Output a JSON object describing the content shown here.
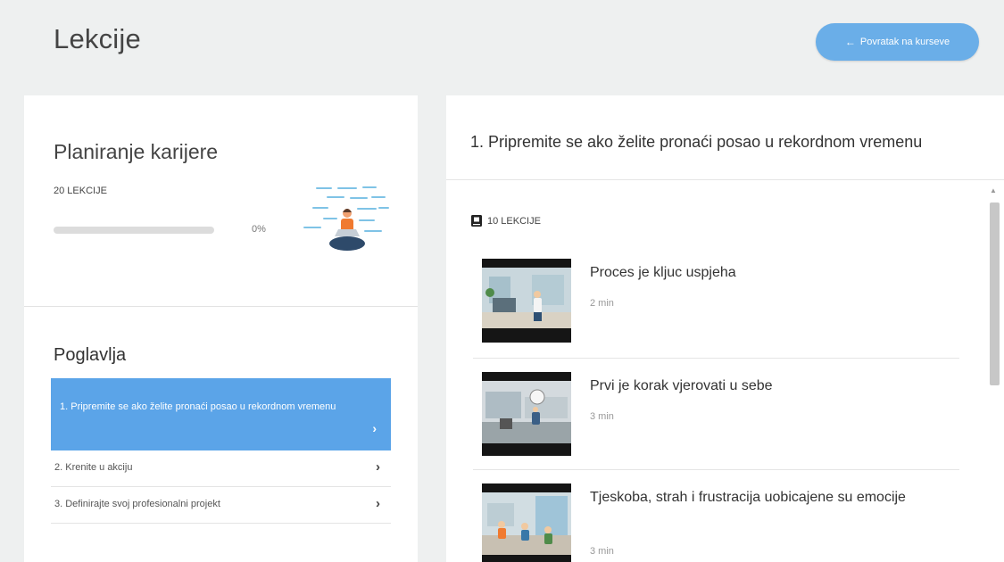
{
  "header": {
    "title": "Lekcije",
    "back_label": "Povratak na kurseve"
  },
  "course": {
    "title": "Planiranje karijere",
    "lessons_count": "20 LEKCIJE",
    "progress_label": "0%",
    "progress_fraction": 0
  },
  "chapters": {
    "heading": "Poglavlja",
    "items": [
      {
        "label": "1. Pripremite se ako želite pronaći posao u rekordnom vremenu",
        "active": true
      },
      {
        "label": "2. Krenite u akciju",
        "active": false
      },
      {
        "label": "3. Definirajte svoj profesionalni projekt",
        "active": false
      }
    ]
  },
  "section": {
    "title": "1. Pripremite se ako želite pronaći posao u rekordnom vremenu",
    "lessons_count": "10 LEKCIJE"
  },
  "lessons": [
    {
      "title": "Proces je kljuc uspjeha",
      "duration": "2 min"
    },
    {
      "title": "Prvi je korak vjerovati u sebe",
      "duration": "3 min"
    },
    {
      "title": "Tjeskoba, strah i frustracija uobicajene su emocije",
      "duration": "3 min"
    }
  ],
  "colors": {
    "accent": "#6aaee8",
    "active_chapter": "#5ba4e8",
    "background": "#eef0f0"
  }
}
